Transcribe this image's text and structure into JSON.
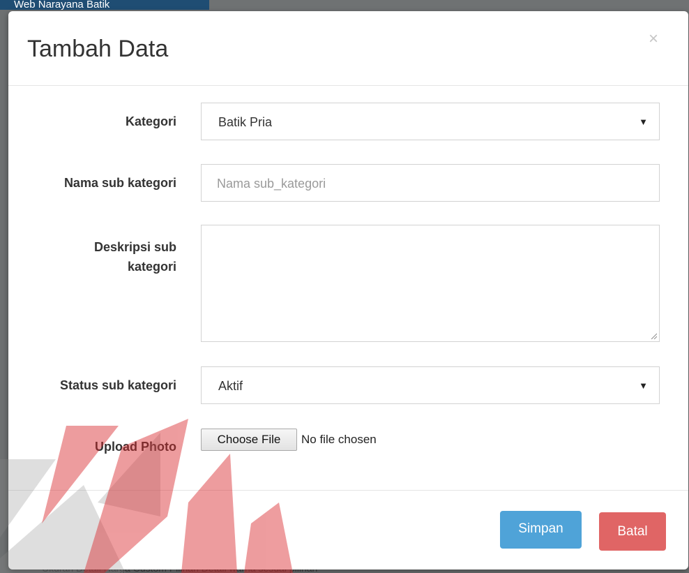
{
  "background": {
    "top_bar_text": "Web Narayana Batik",
    "bottom_text": "Ukuran   Detail   Harga Custom   Pilihan Detail warna sesuai pilihan"
  },
  "modal": {
    "title": "Tambah Data",
    "close_icon": "×"
  },
  "form": {
    "kategori": {
      "label": "Kategori",
      "selected": "Batik Pria"
    },
    "nama_sub_kategori": {
      "label": "Nama sub kategori",
      "placeholder": "Nama sub_kategori",
      "value": ""
    },
    "deskripsi_sub_kategori": {
      "label_line1": "Deskripsi sub",
      "label_line2": "kategori",
      "value": ""
    },
    "status_sub_kategori": {
      "label": "Status sub kategori",
      "selected": "Aktif"
    },
    "upload_photo": {
      "label": "Upload Photo",
      "button_label": "Choose File",
      "status": "No file chosen"
    }
  },
  "footer": {
    "save_label": "Simpan",
    "cancel_label": "Batal"
  },
  "colors": {
    "save_button": "#4fa3d8",
    "cancel_button": "#e06565",
    "watermark_red": "#d9262a",
    "watermark_grey": "#8a8a8a"
  },
  "icons": {
    "select_caret": "caret-down-icon",
    "close": "close-icon",
    "resize": "resize-grip-icon"
  }
}
